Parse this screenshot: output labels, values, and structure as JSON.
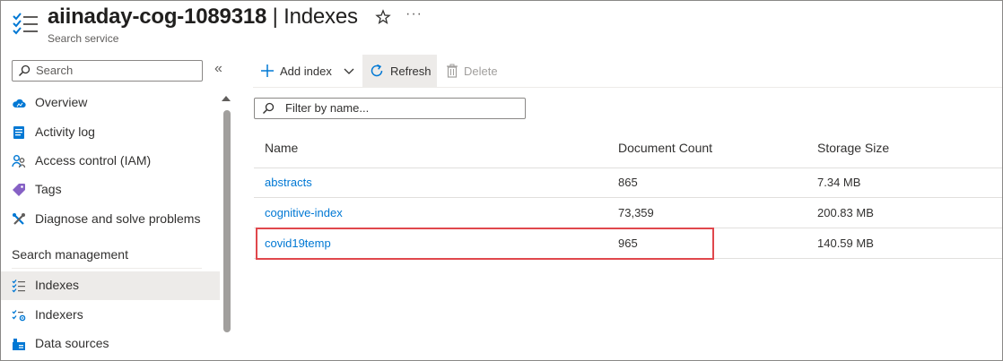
{
  "header": {
    "title_name": "aiinaday-cog-1089318",
    "title_sep": " | ",
    "title_page": "Indexes",
    "subtitle": "Search service",
    "more_label": "···"
  },
  "sidebar": {
    "search_placeholder": "Search",
    "collapse_label": "«",
    "items": [
      {
        "label": "Overview",
        "icon": "cloud-icon"
      },
      {
        "label": "Activity log",
        "icon": "activity-log-icon"
      },
      {
        "label": "Access control (IAM)",
        "icon": "people-icon"
      },
      {
        "label": "Tags",
        "icon": "tag-icon"
      },
      {
        "label": "Diagnose and solve problems",
        "icon": "wrench-icon"
      }
    ],
    "section_title": "Search management",
    "section_items": [
      {
        "label": "Indexes",
        "icon": "indexes-icon",
        "active": true
      },
      {
        "label": "Indexers",
        "icon": "indexers-icon"
      },
      {
        "label": "Data sources",
        "icon": "data-sources-icon"
      }
    ]
  },
  "toolbar": {
    "add_label": "Add index",
    "refresh_label": "Refresh",
    "delete_label": "Delete"
  },
  "filter": {
    "placeholder": "Filter by name..."
  },
  "table": {
    "columns": [
      "Name",
      "Document Count",
      "Storage Size"
    ],
    "rows": [
      {
        "name": "abstracts",
        "count": "865",
        "size": "7.34 MB"
      },
      {
        "name": "cognitive-index",
        "count": "73,359",
        "size": "200.83 MB"
      },
      {
        "name": "covid19temp",
        "count": "965",
        "size": "140.59 MB"
      }
    ]
  },
  "colors": {
    "accent": "#0078d4",
    "highlight": "#e0474c"
  }
}
